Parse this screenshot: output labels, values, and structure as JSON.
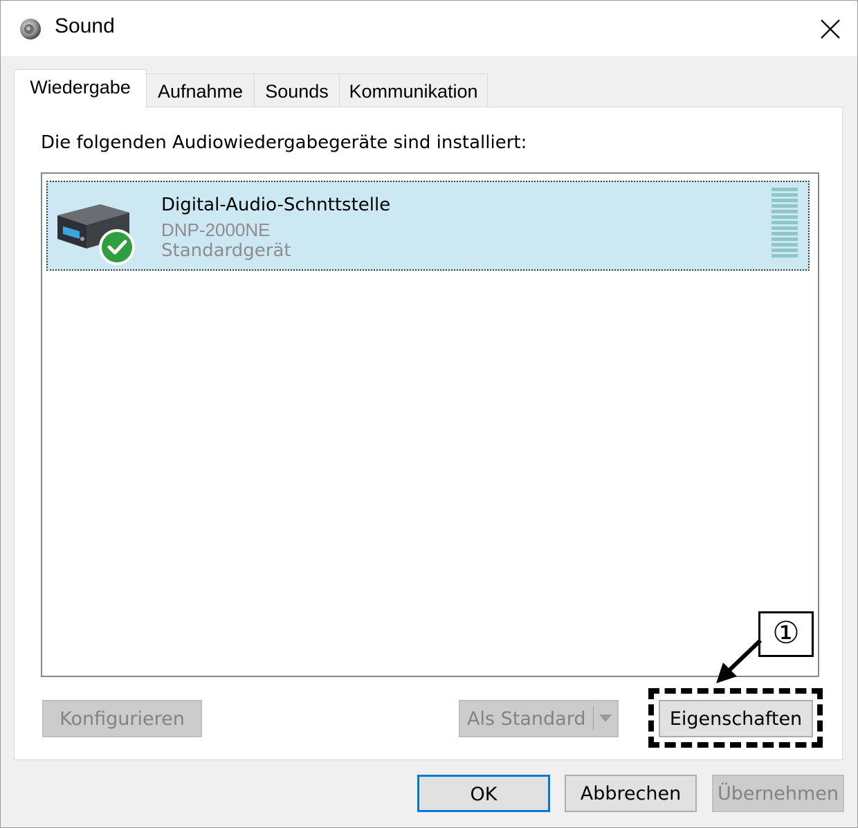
{
  "window": {
    "title": "Sound",
    "icon": "speaker-icon",
    "close_icon": "close-icon"
  },
  "tabs": [
    {
      "label": "Wiedergabe",
      "active": true
    },
    {
      "label": "Aufnahme",
      "active": false
    },
    {
      "label": "Sounds",
      "active": false
    },
    {
      "label": "Kommunikation",
      "active": false
    }
  ],
  "panel": {
    "caption": "Die folgenden Audiowiedergabegeräte sind installiert:",
    "devices": [
      {
        "name": "Digital-Audio-Schnttstelle",
        "model": "DNP-2000NE",
        "status": "Standardgerät",
        "icon": "audio-device-icon",
        "badge_icon": "checkmark-icon",
        "selected": true
      }
    ],
    "buttons": {
      "configure": "Konfigurieren",
      "set_default": "Als Standard",
      "properties": "Eigenschaften"
    }
  },
  "footer": {
    "ok": "OK",
    "cancel": "Abbrechen",
    "apply": "Übernehmen"
  },
  "annotation": {
    "number": "①"
  },
  "colors": {
    "selection": "#cce8f3",
    "focus_border": "#0078d7",
    "badge_green": "#2e9e3e"
  }
}
